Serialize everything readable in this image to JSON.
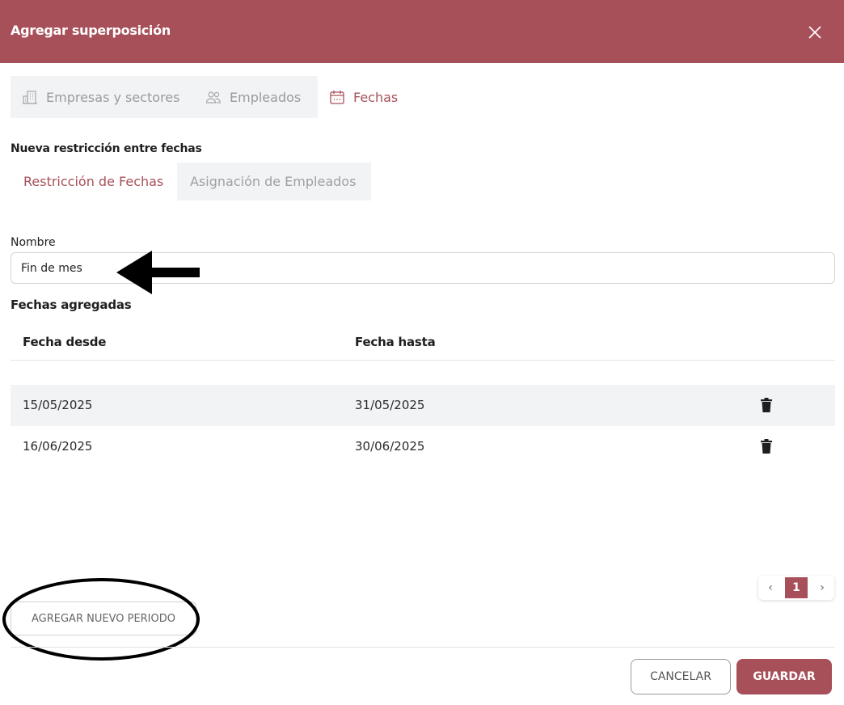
{
  "dialog": {
    "title": "Agregar superposición",
    "close_icon": "close-icon"
  },
  "tabs": [
    {
      "label": "Empresas y sectores",
      "icon": "building-icon"
    },
    {
      "label": "Empleados",
      "icon": "users-icon"
    },
    {
      "label": "Fechas",
      "icon": "calendar-icon",
      "active": true
    }
  ],
  "section_label": "Nueva restricción entre fechas",
  "subtabs": [
    {
      "label": "Restricción de Fechas",
      "active": true
    },
    {
      "label": "Asignación de Empleados"
    }
  ],
  "name_field": {
    "label": "Nombre",
    "value": "Fin de mes"
  },
  "added_dates": {
    "label": "Fechas agregadas",
    "columns": [
      "Fecha desde",
      "Fecha hasta"
    ],
    "rows": [
      {
        "from": "15/05/2025",
        "to": "31/05/2025",
        "action_icon": "trash-icon"
      },
      {
        "from": "16/06/2025",
        "to": "30/06/2025",
        "action_icon": "trash-icon"
      }
    ]
  },
  "pagination": {
    "prev": "‹",
    "current_page": "1",
    "next": "›"
  },
  "add_period_button": "AGREGAR NUEVO PERIODO",
  "footer": {
    "cancel_label": "CANCELAR",
    "save_label": "GUARDAR"
  },
  "colors": {
    "accent": "#a8505a",
    "tab_inactive_bg": "#f1f3f5",
    "row_stripe": "#f1f3f5"
  }
}
